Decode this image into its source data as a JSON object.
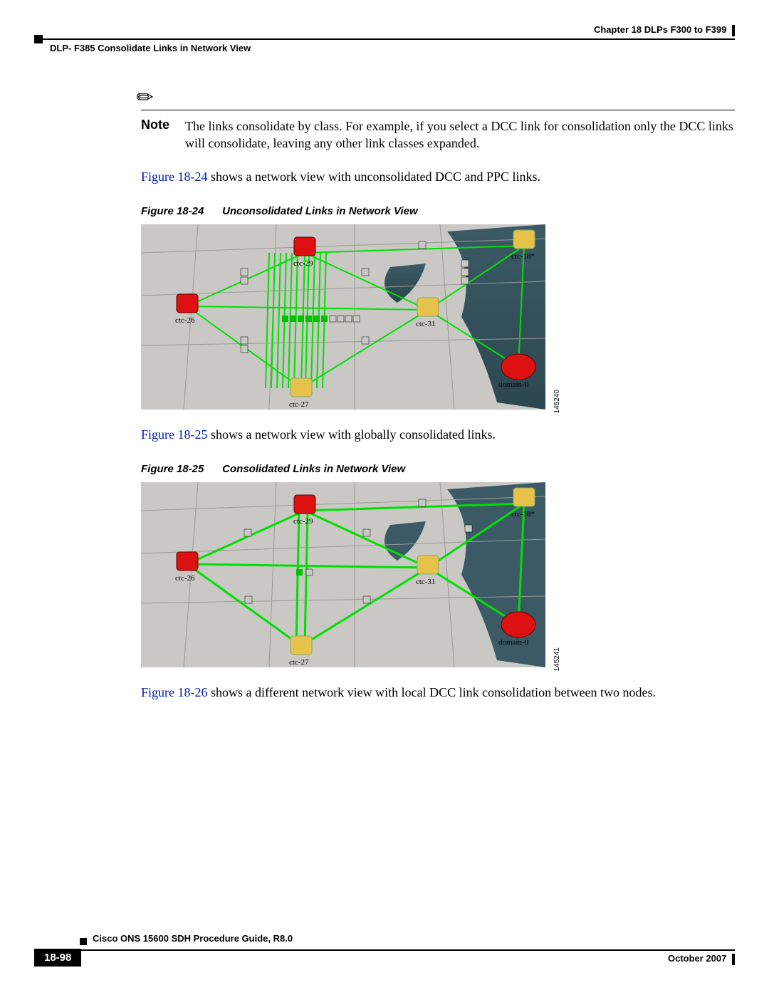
{
  "header": {
    "chapter": "Chapter 18  DLPs F300 to F399",
    "section": "DLP- F385 Consolidate Links in Network View"
  },
  "note": {
    "label": "Note",
    "text": "The links consolidate by class. For example, if you select a DCC link for consolidation only the DCC links will consolidate, leaving any other link classes expanded."
  },
  "para1": {
    "ref": "Figure 18-24",
    "rest": " shows a network view with unconsolidated DCC and PPC links."
  },
  "fig24": {
    "num": "Figure 18-24",
    "title": "Unconsolidated Links in Network View",
    "id": "145240",
    "nodes": {
      "c29": "ctc-29",
      "c18": "ctc-18*",
      "c26": "ctc-26",
      "c31": "ctc-31",
      "c27": "ctc-27",
      "dom": "domain-0"
    }
  },
  "para2": {
    "ref": "Figure 18-25",
    "rest": " shows a network view with globally consolidated links."
  },
  "fig25": {
    "num": "Figure 18-25",
    "title": "Consolidated Links in Network View",
    "id": "145241",
    "nodes": {
      "c29": "ctc-29",
      "c18": "ctc-18*",
      "c26": "ctc-26",
      "c31": "ctc-31",
      "c27": "ctc-27",
      "dom": "domain-0"
    }
  },
  "para3": {
    "ref": "Figure 18-26",
    "rest": " shows a different network view with local DCC link consolidation between two nodes."
  },
  "footer": {
    "title": "Cisco ONS 15600 SDH Procedure Guide, R8.0",
    "page": "18-98",
    "date": "October 2007"
  }
}
